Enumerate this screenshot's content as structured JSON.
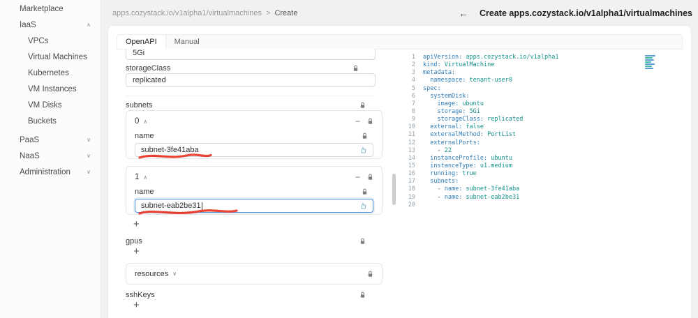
{
  "header": {
    "breadcrumb": {
      "path": "apps.cozystack.io/v1alpha1/virtualmachines",
      "separator": ">",
      "current": "Create"
    },
    "back_arrow": "←",
    "title": "Create apps.cozystack.io/v1alpha1/virtualmachines"
  },
  "sidebar": {
    "items": [
      {
        "label": "Marketplace"
      },
      {
        "label": "IaaS",
        "chevron": "∧"
      },
      {
        "label": "VPCs"
      },
      {
        "label": "Virtual Machines"
      },
      {
        "label": "Kubernetes"
      },
      {
        "label": "VM Instances"
      },
      {
        "label": "VM Disks"
      },
      {
        "label": "Buckets"
      },
      {
        "label": "PaaS",
        "chevron": "∨"
      },
      {
        "label": "NaaS",
        "chevron": "∨"
      },
      {
        "label": "Administration",
        "chevron": "∨"
      }
    ]
  },
  "tabs": {
    "openapi": "OpenAPI",
    "manual": "Manual"
  },
  "form": {
    "top_partial_value": "5Gi",
    "storage_class": {
      "label": "storageClass",
      "value": "replicated"
    },
    "subnets": {
      "label": "subnets",
      "items": [
        {
          "index": "0",
          "collapse": "∧",
          "remove": "−",
          "name_label": "name",
          "value": "subnet-3fe41aba"
        },
        {
          "index": "1",
          "collapse": "∧",
          "remove": "−",
          "name_label": "name",
          "value": "subnet-eab2be31"
        }
      ],
      "add": "+"
    },
    "gpus": {
      "label": "gpus",
      "add": "+"
    },
    "resources": {
      "label": "resources",
      "chevron": "∨"
    },
    "ssh_keys": {
      "label": "sshKeys",
      "add": "+"
    }
  },
  "editor": {
    "lines": [
      {
        "n": "1",
        "pre": "",
        "key": "apiVersion:",
        "val": " apps.cozystack.io/v1alpha1"
      },
      {
        "n": "2",
        "pre": "",
        "key": "kind:",
        "val": " VirtualMachine"
      },
      {
        "n": "3",
        "pre": "",
        "key": "metadata:",
        "val": ""
      },
      {
        "n": "4",
        "pre": "  ",
        "key": "namespace:",
        "val": " tenant-user0"
      },
      {
        "n": "5",
        "pre": "",
        "key": "spec:",
        "val": ""
      },
      {
        "n": "6",
        "pre": "  ",
        "key": "systemDisk:",
        "val": ""
      },
      {
        "n": "7",
        "pre": "    ",
        "key": "image:",
        "val": " ubuntu"
      },
      {
        "n": "8",
        "pre": "    ",
        "key": "storage:",
        "val": " 5Gi"
      },
      {
        "n": "9",
        "pre": "    ",
        "key": "storageClass:",
        "val": " replicated"
      },
      {
        "n": "10",
        "pre": "  ",
        "key": "external:",
        "val": " false"
      },
      {
        "n": "11",
        "pre": "  ",
        "key": "externalMethod:",
        "val": " PortList"
      },
      {
        "n": "12",
        "pre": "  ",
        "key": "externalPorts:",
        "val": ""
      },
      {
        "n": "13",
        "pre": "    - ",
        "key": "",
        "val": "22"
      },
      {
        "n": "14",
        "pre": "  ",
        "key": "instanceProfile:",
        "val": " ubuntu"
      },
      {
        "n": "15",
        "pre": "  ",
        "key": "instanceType:",
        "val": " u1.medium"
      },
      {
        "n": "16",
        "pre": "  ",
        "key": "running:",
        "val": " true"
      },
      {
        "n": "17",
        "pre": "  ",
        "key": "subnets:",
        "val": ""
      },
      {
        "n": "18",
        "pre": "    - ",
        "key": "name:",
        "val": " subnet-3fe41aba"
      },
      {
        "n": "19",
        "pre": "    - ",
        "key": "name:",
        "val": " subnet-eab2be31"
      },
      {
        "n": "20",
        "pre": "",
        "key": "",
        "val": ""
      }
    ]
  }
}
